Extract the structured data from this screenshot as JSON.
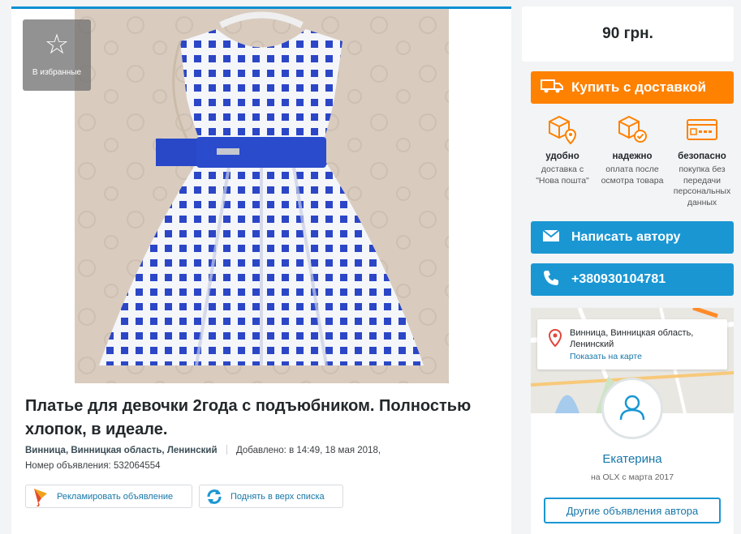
{
  "gallery": {
    "favorite_label": "В избранные",
    "favorite_icon": "star-icon"
  },
  "listing": {
    "title": "Платье для девочки 2года с подъюбником. Полностью хлопок, в идеале.",
    "location": "Винница, Винницкая область, Ленинский",
    "added": "Добавлено: в 14:49, 18 мая 2018,",
    "ad_number": "Номер объявления: 532064554"
  },
  "actions": {
    "promote_label": "Рекламировать объявление",
    "raise_label": "Поднять в верх списка"
  },
  "sidebar": {
    "price": "90 грн.",
    "buy_label": "Купить с доставкой",
    "features": [
      {
        "title": "удобно",
        "desc": "доставка с \"Нова пошта\"",
        "icon": "box-location-icon"
      },
      {
        "title": "надежно",
        "desc": "оплата после осмотра товара",
        "icon": "box-check-icon"
      },
      {
        "title": "безопасно",
        "desc": "покупка без передачи персональных данных",
        "icon": "card-icon"
      }
    ],
    "message_label": "Написать автору",
    "phone_label": "+380930104781"
  },
  "seller": {
    "location": "Винница, Винницкая область, Ленинский",
    "map_link": "Показать на карте",
    "name": "Екатерина",
    "since": "на OLX с марта 2017",
    "other_ads_label": "Другие объявления автора"
  },
  "colors": {
    "accent_orange": "#ff8100",
    "accent_blue": "#1a97d3",
    "link_blue": "#1677a9"
  }
}
